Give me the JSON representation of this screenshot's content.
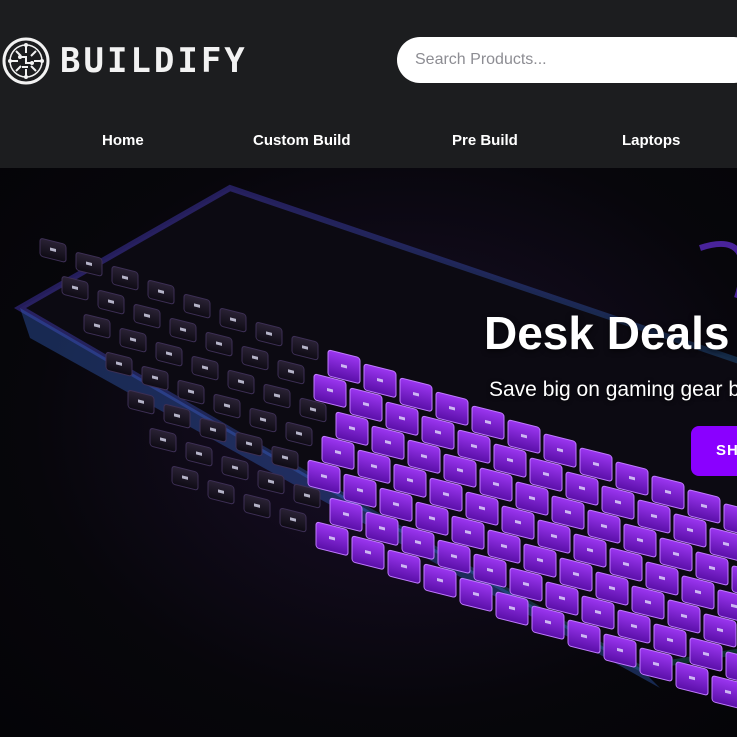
{
  "header": {
    "logo_text": "BUILDIFY",
    "logo_icon": "circuit-brain-icon",
    "search_placeholder": "Search Products..."
  },
  "nav": {
    "items": [
      {
        "label": "Home"
      },
      {
        "label": "Custom Build"
      },
      {
        "label": "Pre Build"
      },
      {
        "label": "Laptops"
      }
    ]
  },
  "hero": {
    "title": "Desk Deals",
    "subtitle": "Save big on gaming gear b",
    "button_label": "SH",
    "image": "rgb-mechanical-keyboard"
  },
  "colors": {
    "header_bg": "#1c1d1f",
    "accent": "#8a00ff",
    "key_purple": "#7a1fd6",
    "backlight_blue": "#5ab8ff"
  }
}
